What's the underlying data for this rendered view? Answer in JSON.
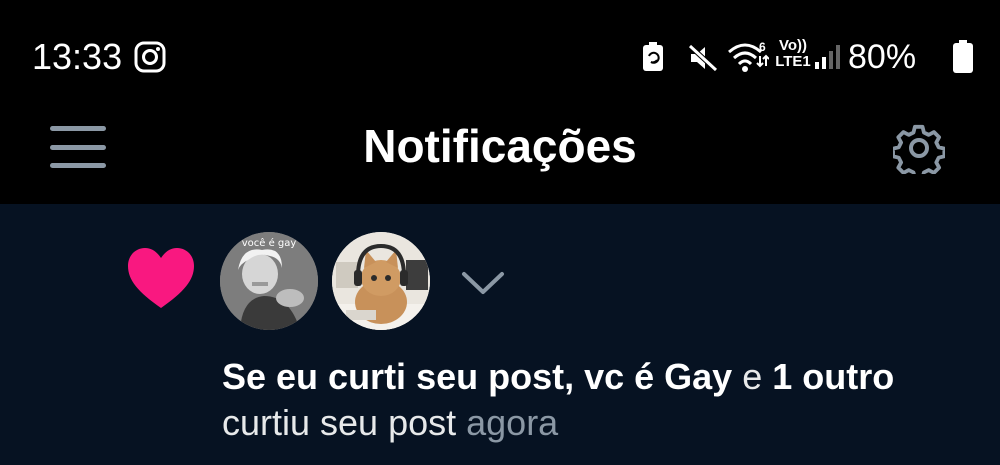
{
  "status_bar": {
    "time": "13:33",
    "network_label": "Vo))\nLTE1",
    "battery": "80%",
    "icons": [
      "instagram-icon",
      "battery-saver-icon",
      "mute-icon",
      "wifi-6-icon",
      "signal-icon",
      "battery-icon"
    ]
  },
  "header": {
    "title": "Notificações",
    "menu_icon": "hamburger-menu-icon",
    "settings_icon": "gear-icon"
  },
  "notification": {
    "icon": "heart-icon",
    "accent_color": "#f91880",
    "avatars": [
      {
        "caption": "você é gay"
      },
      {
        "caption": ""
      }
    ],
    "expand_icon": "chevron-down-icon",
    "actor": "Se eu curti seu post, vc é Gay",
    "connector": " e ",
    "others": "1 outro",
    "action": " curtiu seu post ",
    "time": "agora"
  },
  "colors": {
    "background": "#000000",
    "content_background": "#061222",
    "muted_text": "#8b98a5"
  }
}
